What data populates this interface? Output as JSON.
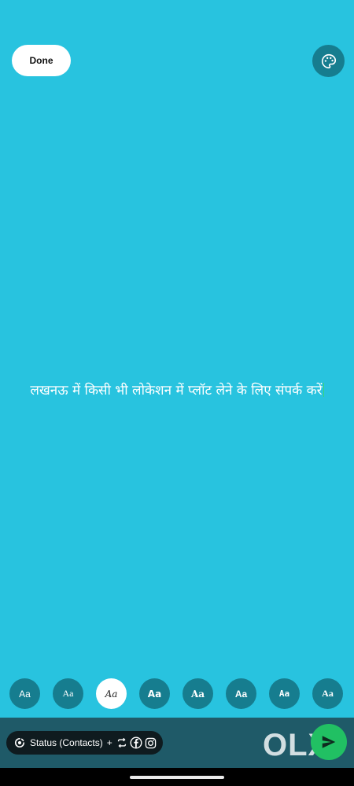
{
  "header": {
    "done_label": "Done",
    "palette_icon": "palette-icon"
  },
  "editor": {
    "text": "लखनऊ में किसी भी लोकेशन में प्लॉट लेने के लिए संपर्क करें",
    "background_color": "#28c3df"
  },
  "font_picker": {
    "options": [
      {
        "label": "Aa",
        "selected": false
      },
      {
        "label": "Aa",
        "selected": false
      },
      {
        "label": "Aa",
        "selected": true
      },
      {
        "label": "Aa",
        "selected": false
      },
      {
        "label": "Aa",
        "selected": false
      },
      {
        "label": "Aa",
        "selected": false
      },
      {
        "label": "Aa",
        "selected": false
      },
      {
        "label": "Aa",
        "selected": false
      }
    ]
  },
  "bottom_bar": {
    "audience_label": "Status (Contacts)",
    "plus": "+",
    "watermark": "OLX",
    "send_icon": "send-icon",
    "send_color": "#21c063"
  }
}
